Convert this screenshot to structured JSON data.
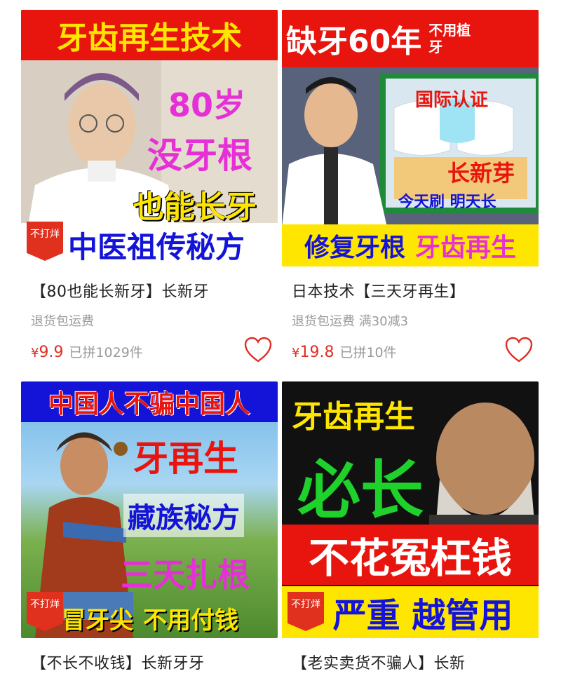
{
  "products": [
    {
      "banner_top": "牙齿再生技术",
      "overlay_lines": [
        "80岁",
        "没牙根",
        "也能长牙"
      ],
      "banner_bottom": "中医祖传秘方",
      "stamp": "不打烊",
      "title": "【80也能长新牙】长新牙",
      "tags": "退货包运费",
      "currency": "¥",
      "price": "9.9",
      "sold": "已拼1029件"
    },
    {
      "banner_top": "缺牙60年",
      "banner_top_side": "不用植牙",
      "overlay_cert": "国际认证",
      "overlay_grow": "长新芽",
      "overlay_brush": "今天刷 明天长",
      "banner_bottom_left": "修复牙根",
      "banner_bottom_right": "牙齿再生",
      "title": "日本技术【三天牙再生】",
      "tags": "退货包运费  满30减3",
      "currency": "¥",
      "price": "19.8",
      "sold": "已拼10件"
    },
    {
      "banner_top": "中国人不骗中国人",
      "overlay_lines": [
        "牙再生",
        "藏族秘方",
        "三天扎根"
      ],
      "banner_bottom_left": "冒牙尖",
      "banner_bottom_right": "不用付钱",
      "stamp": "不打烊",
      "title": "【不长不收钱】长新牙牙"
    },
    {
      "overlay_top": "牙齿再生",
      "overlay_big": "必长",
      "banner_mid": "不花冤枉钱",
      "banner_bottom": "严重 越管用",
      "stamp": "不打烊",
      "title": "【老实卖货不骗人】长新"
    }
  ],
  "colors": {
    "price_red": "#e02e24",
    "grey_text": "#9a9a9a",
    "banner_red": "#e8140e",
    "banner_yellow": "#ffe600",
    "banner_blue": "#1414d8"
  },
  "icons": {
    "favorite": "heart-outline-icon"
  }
}
